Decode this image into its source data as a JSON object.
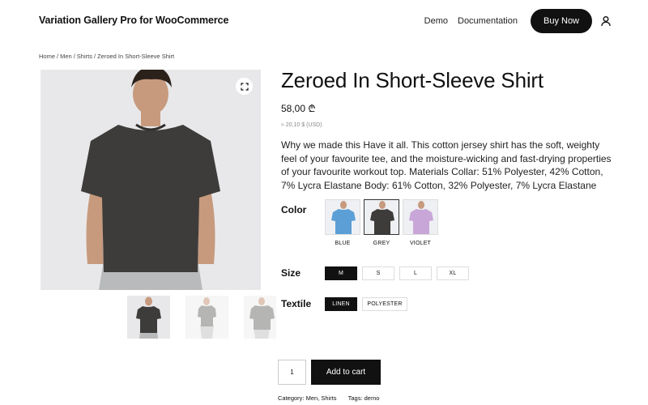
{
  "header": {
    "brand": "Variation Gallery Pro for WooCommerce",
    "nav": [
      "Demo",
      "Documentation"
    ],
    "buy_label": "Buy Now"
  },
  "breadcrumb": [
    "Home",
    "Men",
    "Shirts",
    "Zeroed In Short-Sleeve Shirt"
  ],
  "product": {
    "title": "Zeroed In Short-Sleeve Shirt",
    "price": "58,00 ₾",
    "price_alt": "≈ 20,10 $ (USD)",
    "description": "Why we made this Have it all. This cotton jersey shirt has the soft, weighty feel of your favourite tee, and the moisture-wicking and fast-drying properties of your favourite workout top. Materials Collar: 51% Polyester, 42% Cotton, 7% Lycra Elastane Body: 61% Cotton, 32% Polyester, 7% Lycra Elastane"
  },
  "attributes": {
    "color_label": "Color",
    "colors": [
      {
        "name": "BLUE",
        "hex": "#5b9fd6",
        "selected": false
      },
      {
        "name": "GREY",
        "hex": "#3d3c3a",
        "selected": true
      },
      {
        "name": "VIOLET",
        "hex": "#c9a6d8",
        "selected": false
      }
    ],
    "size_label": "Size",
    "sizes": [
      {
        "name": "M",
        "active": true
      },
      {
        "name": "S",
        "active": false
      },
      {
        "name": "L",
        "active": false
      },
      {
        "name": "XL",
        "active": false
      }
    ],
    "textile_label": "Textile",
    "textiles": [
      {
        "name": "LINEN",
        "active": true
      },
      {
        "name": "POLYESTER",
        "active": false
      }
    ]
  },
  "cart": {
    "quantity": "1",
    "add_label": "Add to cart"
  },
  "meta": {
    "category_label": "Category:",
    "category_value": "Men, Shirts",
    "tags_label": "Tags:",
    "tags_value": "demo"
  },
  "icons": {
    "user": "user-icon",
    "zoom": "fullscreen-icon"
  },
  "colors": {
    "accent": "#111111",
    "image_bg": "#e8e8ea",
    "shirt": "#3d3c3a",
    "pants": "#b9babc",
    "skin": "#c79a7e"
  }
}
